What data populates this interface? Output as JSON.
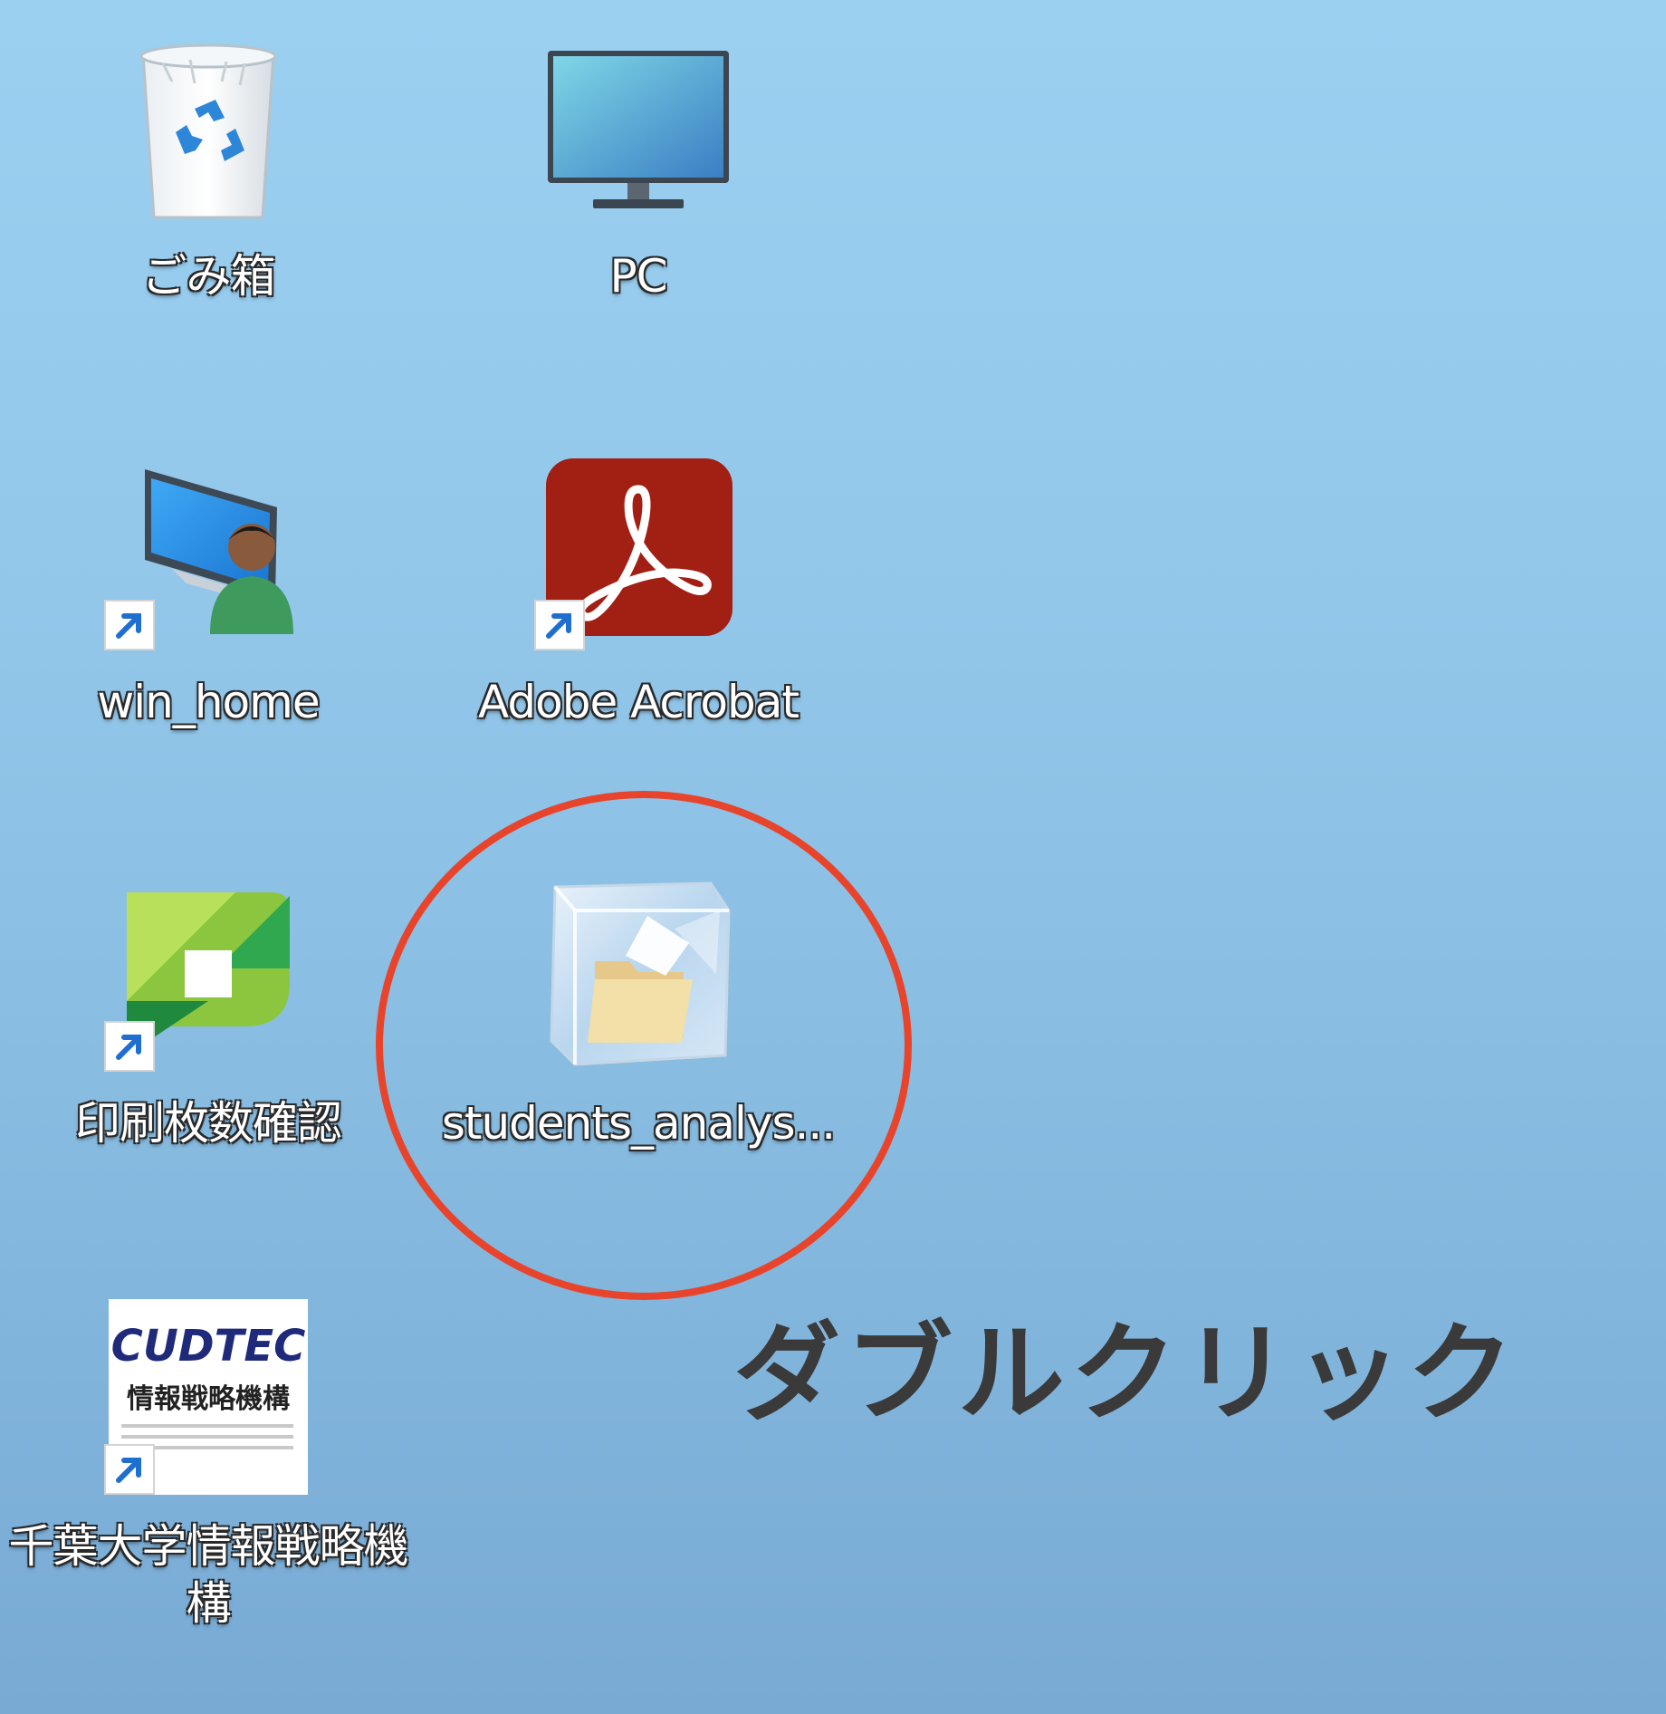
{
  "desktop": {
    "icons": [
      {
        "label": "ごみ箱",
        "icon": "recycle-bin-icon"
      },
      {
        "label": "PC",
        "icon": "monitor-icon"
      },
      {
        "label": "win_home",
        "icon": "user-computer-icon",
        "shortcut": true
      },
      {
        "label": "Adobe Acrobat",
        "icon": "acrobat-icon",
        "shortcut": true
      },
      {
        "label": "印刷枚数確認",
        "icon": "print-counter-icon",
        "shortcut": true
      },
      {
        "label": "students_analys...",
        "icon": "frozen-folder-icon"
      },
      {
        "label": "千葉大学情報戦略機構",
        "icon": "cudtec-icon",
        "shortcut": true
      }
    ]
  },
  "cudtec_logo": {
    "wordmark": "CUDTEC",
    "subtitle": "情報戦略機構"
  },
  "annotation": {
    "text": "ダブルクリック",
    "highlight_color": "#e8442b"
  }
}
